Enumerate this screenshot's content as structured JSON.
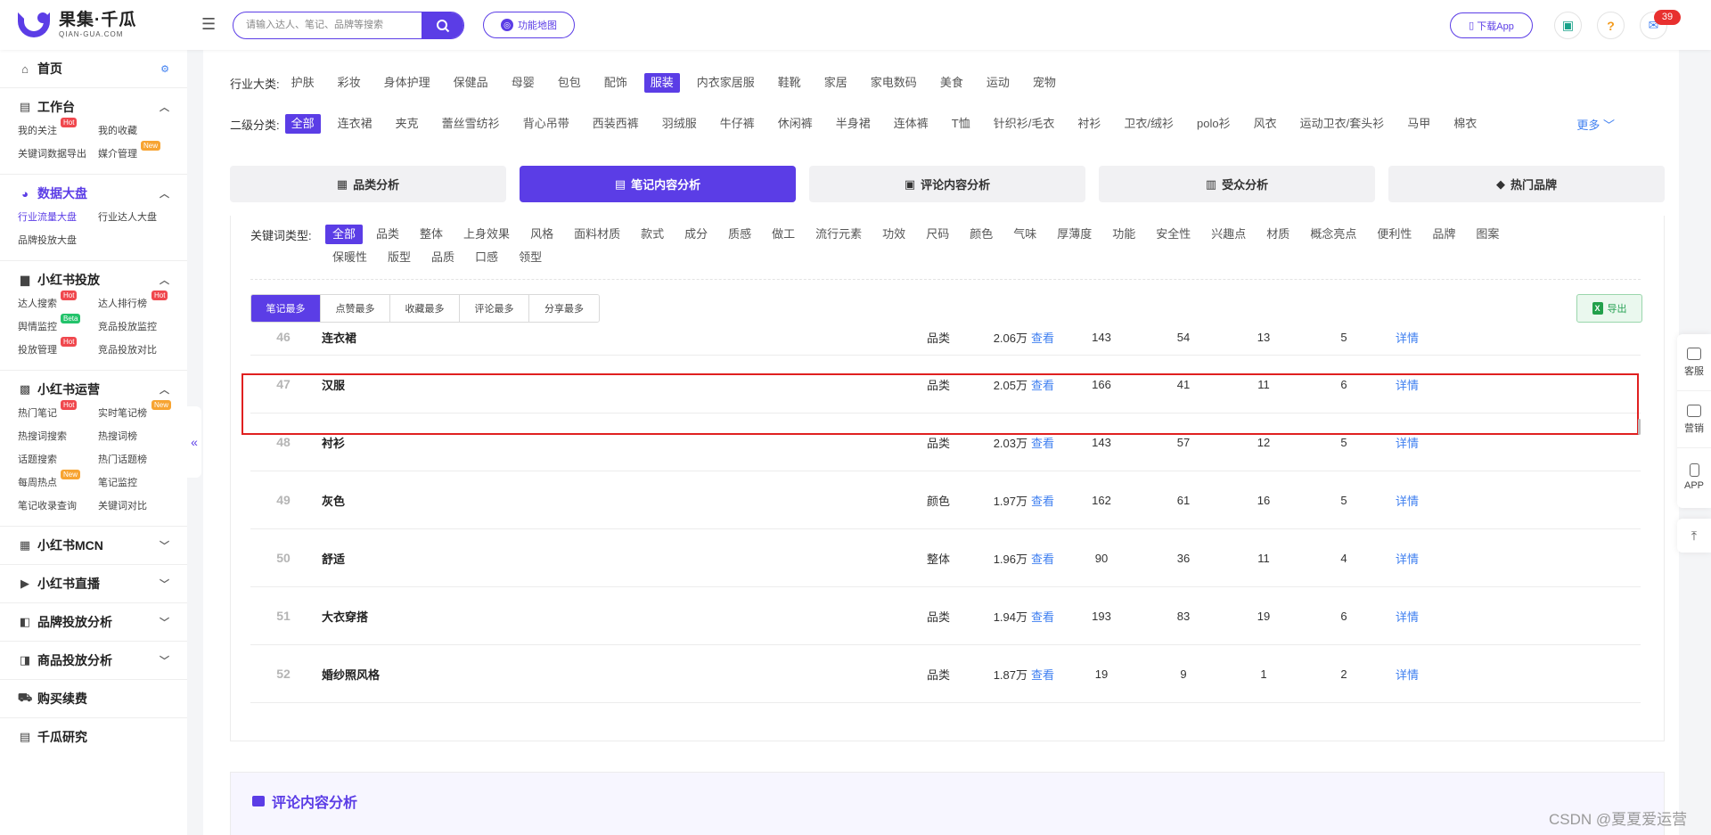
{
  "header": {
    "logo_cn": "果集·千瓜",
    "logo_en": "QIAN-GUA.COM",
    "search_placeholder": "请输入达人、笔记、品牌等搜索",
    "func_map_label": "功能地图",
    "download_label": "下载App",
    "notification_count": "39",
    "help_glyph": "?"
  },
  "sidebar": {
    "home": "首页",
    "sections": [
      {
        "title": "工作台",
        "items": [
          {
            "label": "我的关注",
            "tag": "Hot"
          },
          {
            "label": "我的收藏",
            "tag": ""
          },
          {
            "label": "关键词数据导出",
            "tag": ""
          },
          {
            "label": "媒介管理",
            "tag": "New"
          }
        ]
      },
      {
        "title": "数据大盘",
        "items": [
          {
            "label": "行业流量大盘",
            "tag": ""
          },
          {
            "label": "行业达人大盘",
            "tag": ""
          },
          {
            "label": "品牌投放大盘",
            "tag": ""
          }
        ]
      },
      {
        "title": "小红书投放",
        "items": [
          {
            "label": "达人搜索",
            "tag": "Hot"
          },
          {
            "label": "达人排行榜",
            "tag": "Hot"
          },
          {
            "label": "舆情监控",
            "tag": "Beta"
          },
          {
            "label": "竞品投放监控",
            "tag": ""
          },
          {
            "label": "投放管理",
            "tag": "Hot"
          },
          {
            "label": "竞品投放对比",
            "tag": ""
          }
        ]
      },
      {
        "title": "小红书运营",
        "items": [
          {
            "label": "热门笔记",
            "tag": "Hot"
          },
          {
            "label": "实时笔记榜",
            "tag": "New"
          },
          {
            "label": "热搜词搜索",
            "tag": ""
          },
          {
            "label": "热搜词榜",
            "tag": ""
          },
          {
            "label": "话题搜索",
            "tag": ""
          },
          {
            "label": "热门话题榜",
            "tag": ""
          },
          {
            "label": "每周热点",
            "tag": "New"
          },
          {
            "label": "笔记监控",
            "tag": ""
          },
          {
            "label": "笔记收录查询",
            "tag": ""
          },
          {
            "label": "关键词对比",
            "tag": ""
          }
        ]
      }
    ],
    "collapsed": [
      "小红书MCN",
      "小红书直播",
      "品牌投放分析",
      "商品投放分析"
    ],
    "purchase": "购买续费",
    "cut_off": "千瓜研究"
  },
  "filters": {
    "industry_label": "行业大类:",
    "industries": [
      "护肤",
      "彩妆",
      "身体护理",
      "保健品",
      "母婴",
      "包包",
      "配饰",
      "服装",
      "内衣家居服",
      "鞋靴",
      "家居",
      "家电数码",
      "美食",
      "运动",
      "宠物"
    ],
    "industry_selected": "服装",
    "sub_label": "二级分类:",
    "subs": [
      "全部",
      "连衣裙",
      "夹克",
      "蕾丝雪纺衫",
      "背心吊带",
      "西装西裤",
      "羽绒服",
      "牛仔裤",
      "休闲裤",
      "半身裙",
      "连体裤",
      "T恤",
      "针织衫/毛衣",
      "衬衫",
      "卫衣/绒衫",
      "polo衫",
      "风衣",
      "运动卫衣/套头衫",
      "马甲",
      "棉衣"
    ],
    "sub_selected": "全部",
    "more": "更多 ﹀"
  },
  "tabs": [
    "品类分析",
    "笔记内容分析",
    "评论内容分析",
    "受众分析",
    "热门品牌"
  ],
  "tab_selected": 1,
  "keywords": {
    "label": "关键词类型:",
    "line1": [
      "全部",
      "品类",
      "整体",
      "上身效果",
      "风格",
      "面料材质",
      "款式",
      "成分",
      "质感",
      "做工",
      "流行元素",
      "功效",
      "尺码",
      "颜色",
      "气味",
      "厚薄度",
      "功能",
      "安全性",
      "兴趣点",
      "材质",
      "概念亮点",
      "便利性",
      "品牌",
      "图案"
    ],
    "line2": [
      "保暖性",
      "版型",
      "品质",
      "口感",
      "领型"
    ],
    "selected": "全部"
  },
  "sort_buttons": [
    "笔记最多",
    "点赞最多",
    "收藏最多",
    "评论最多",
    "分享最多"
  ],
  "sort_selected": 0,
  "export_label": "导出",
  "view_label": "查看",
  "detail_label": "详情",
  "rows": [
    {
      "rank": "46",
      "keyword": "连衣裙",
      "type": "品类",
      "notes": "2.06万",
      "n1": "143",
      "n2": "54",
      "n3": "13",
      "n4": "5"
    },
    {
      "rank": "47",
      "keyword": "汉服",
      "type": "品类",
      "notes": "2.05万",
      "n1": "166",
      "n2": "41",
      "n3": "11",
      "n4": "6"
    },
    {
      "rank": "48",
      "keyword": "衬衫",
      "type": "品类",
      "notes": "2.03万",
      "n1": "143",
      "n2": "57",
      "n3": "12",
      "n4": "5"
    },
    {
      "rank": "49",
      "keyword": "灰色",
      "type": "颜色",
      "notes": "1.97万",
      "n1": "162",
      "n2": "61",
      "n3": "16",
      "n4": "5"
    },
    {
      "rank": "50",
      "keyword": "舒适",
      "type": "整体",
      "notes": "1.96万",
      "n1": "90",
      "n2": "36",
      "n3": "11",
      "n4": "4"
    },
    {
      "rank": "51",
      "keyword": "大衣穿搭",
      "type": "品类",
      "notes": "1.94万",
      "n1": "193",
      "n2": "83",
      "n3": "19",
      "n4": "6"
    },
    {
      "rank": "52",
      "keyword": "婚纱照风格",
      "type": "品类",
      "notes": "1.87万",
      "n1": "19",
      "n2": "9",
      "n3": "1",
      "n4": "2"
    }
  ],
  "bottom_title": "评论内容分析",
  "float": [
    "客服",
    "营销",
    "APP"
  ],
  "watermark": "CSDN @夏夏爱运营"
}
